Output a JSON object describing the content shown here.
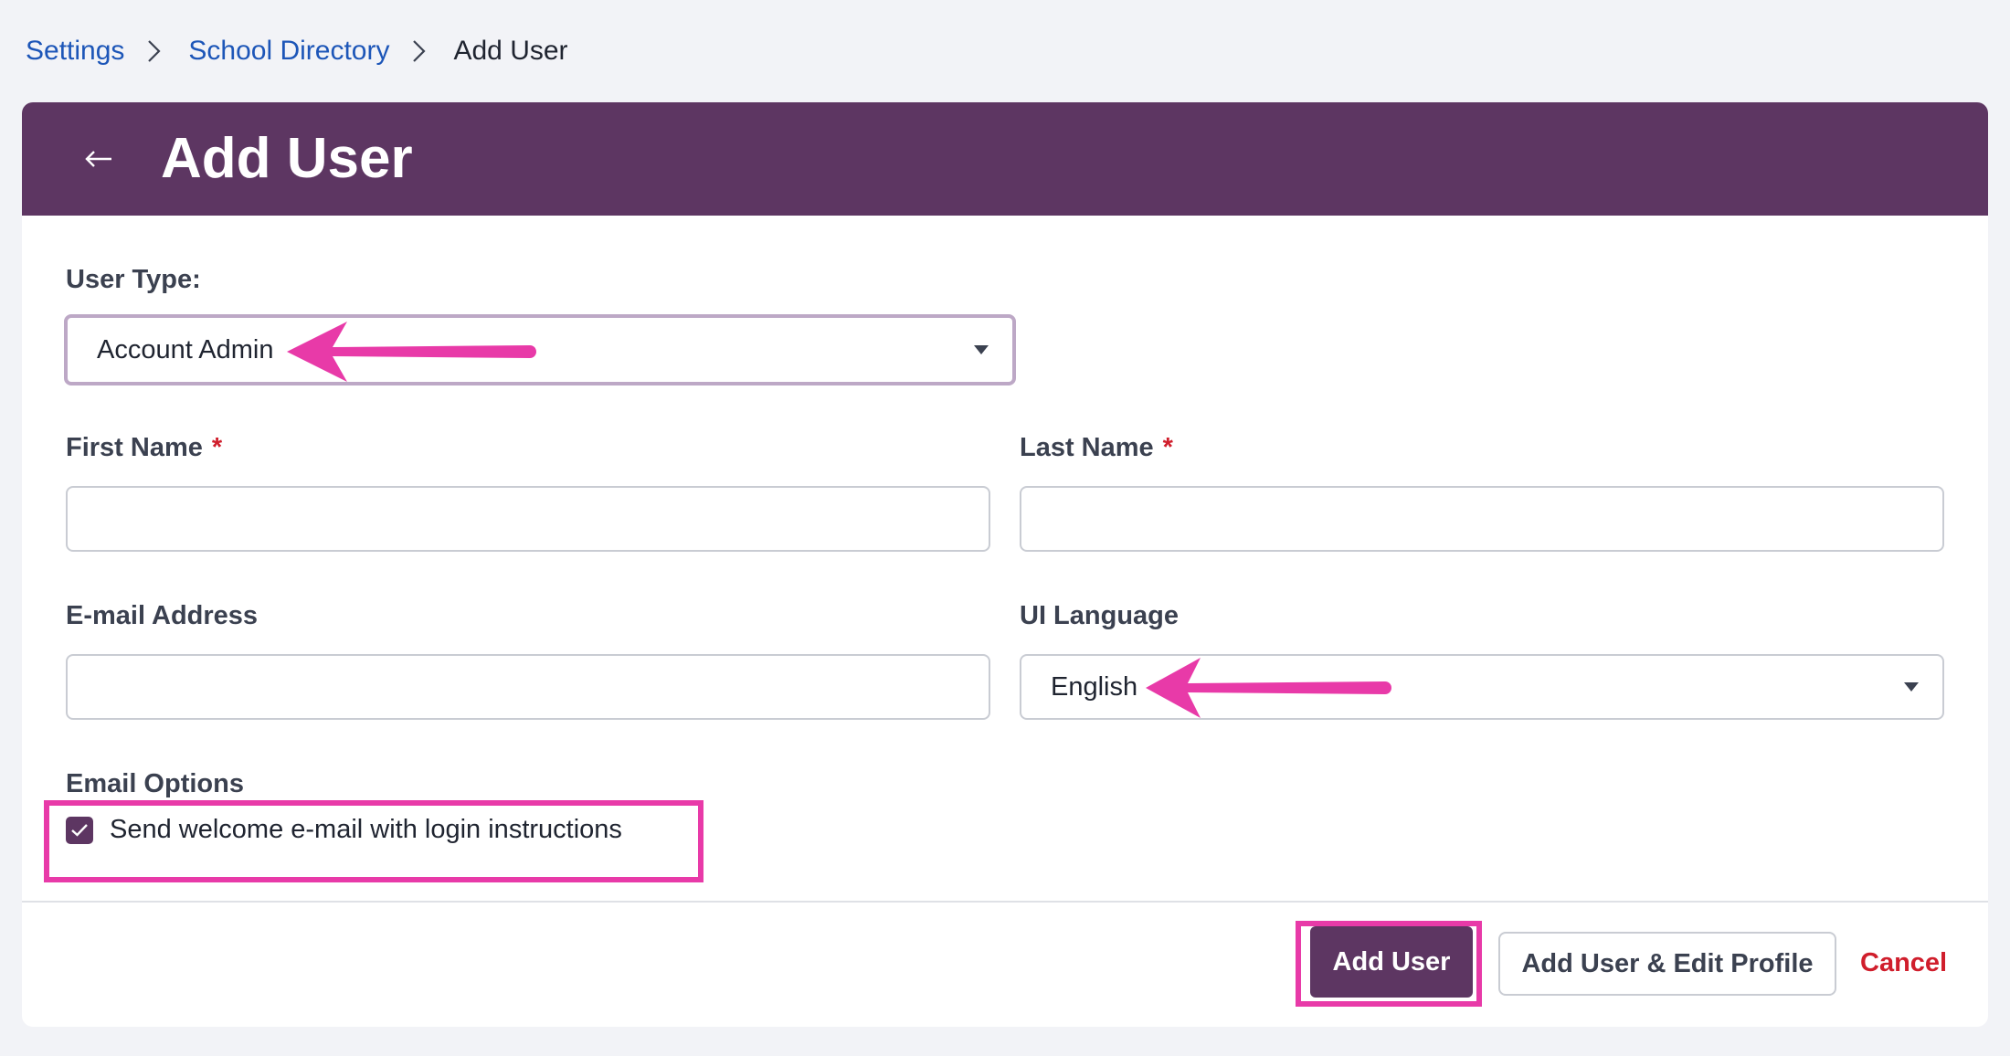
{
  "breadcrumb": {
    "items": [
      {
        "label": "Settings"
      },
      {
        "label": "School Directory"
      },
      {
        "label": "Add User"
      }
    ]
  },
  "header": {
    "title": "Add User"
  },
  "form": {
    "user_type": {
      "label": "User Type:",
      "value": "Account Admin"
    },
    "first_name": {
      "label": "First Name",
      "required_mark": "*",
      "value": "",
      "placeholder": ""
    },
    "last_name": {
      "label": "Last Name",
      "required_mark": "*",
      "value": "",
      "placeholder": ""
    },
    "email": {
      "label": "E-mail Address",
      "value": "",
      "placeholder": ""
    },
    "ui_language": {
      "label": "UI Language",
      "value": "English"
    },
    "email_options": {
      "label": "Email Options",
      "welcome_email": {
        "label": "Send welcome e-mail with login instructions",
        "checked": true
      }
    }
  },
  "actions": {
    "add_user": "Add User",
    "add_user_edit_profile": "Add User & Edit Profile",
    "cancel": "Cancel"
  },
  "colors": {
    "header_bg": "#5d3662",
    "link": "#1d56b8",
    "required": "#d01e2c",
    "annotation": "#e83aa8"
  },
  "icons": {
    "breadcrumb_separator": "chevron-right-icon",
    "back": "arrow-left-icon",
    "dropdown": "caret-down-icon",
    "checkbox": "checkmark-icon"
  }
}
